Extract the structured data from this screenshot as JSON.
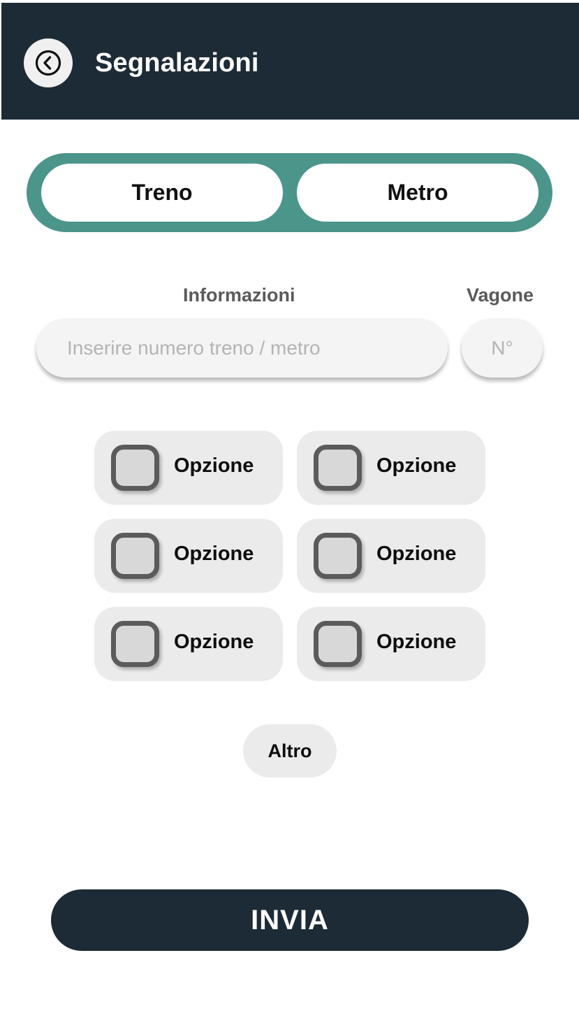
{
  "header": {
    "title": "Segnalazioni",
    "back_icon": "chevron-left-circle-icon",
    "background_color": "#1c2b36"
  },
  "segment": {
    "background_color": "#4b958b",
    "options": [
      {
        "label": "Treno"
      },
      {
        "label": "Metro"
      }
    ]
  },
  "form": {
    "info_label": "Informazioni",
    "info_placeholder": "Inserire numero treno / metro",
    "info_value": "",
    "vagone_label": "Vagone",
    "vagone_placeholder": "N°",
    "vagone_value": ""
  },
  "options": [
    {
      "label": "Opzione",
      "checked": false
    },
    {
      "label": "Opzione",
      "checked": false
    },
    {
      "label": "Opzione",
      "checked": false
    },
    {
      "label": "Opzione",
      "checked": false
    },
    {
      "label": "Opzione",
      "checked": false
    },
    {
      "label": "Opzione",
      "checked": false
    }
  ],
  "altro_label": "Altro",
  "submit_label": "INVIA"
}
